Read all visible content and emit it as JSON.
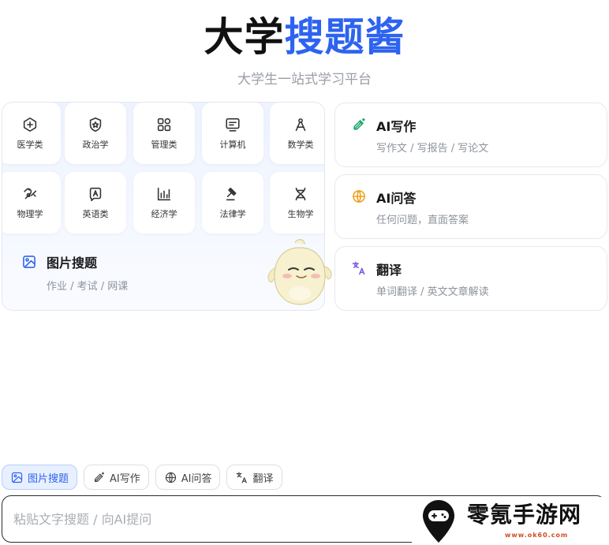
{
  "header": {
    "title_black": "大学",
    "title_blue": "搜题酱",
    "subtitle": "大学生一站式学习平台"
  },
  "categories": [
    {
      "label": "医学类",
      "icon": "medical-cross-icon"
    },
    {
      "label": "政治学",
      "icon": "emblem-icon"
    },
    {
      "label": "管理类",
      "icon": "grid-blocks-icon"
    },
    {
      "label": "计算机",
      "icon": "monitor-icon"
    },
    {
      "label": "数学类",
      "icon": "compass-icon"
    },
    {
      "label": "物理学",
      "icon": "magnet-icon"
    },
    {
      "label": "英语类",
      "icon": "letter-a-icon"
    },
    {
      "label": "经济学",
      "icon": "bar-chart-icon"
    },
    {
      "label": "法律学",
      "icon": "gavel-icon"
    },
    {
      "label": "生物学",
      "icon": "dna-icon"
    }
  ],
  "image_search": {
    "title": "图片搜题",
    "desc": "作业 / 考试 / 网课",
    "icon": "image-icon"
  },
  "features": [
    {
      "title": "AI写作",
      "desc": "写作文 / 写报告 / 写论文",
      "icon": "magic-pen-icon",
      "color": "#1aa86b"
    },
    {
      "title": "AI问答",
      "desc": "任何问题，直面答案",
      "icon": "globe-icon",
      "color": "#f0a020"
    },
    {
      "title": "翻译",
      "desc": "单词翻译 / 英文文章解读",
      "icon": "translate-icon",
      "color": "#7b55e0"
    }
  ],
  "chips": [
    {
      "label": "图片搜题",
      "icon": "image-icon",
      "active": true
    },
    {
      "label": "AI写作",
      "icon": "magic-pen-icon",
      "active": false
    },
    {
      "label": "AI问答",
      "icon": "globe-icon",
      "active": false
    },
    {
      "label": "翻译",
      "icon": "translate-icon",
      "active": false
    }
  ],
  "input": {
    "placeholder": "粘贴文字搜题 / 向AI提问"
  },
  "watermark": {
    "text": "零氪手游网",
    "url": "www.ok60.com"
  },
  "colors": {
    "brand_blue": "#2d63f0",
    "chip_active_bg": "#e8f0ff"
  }
}
